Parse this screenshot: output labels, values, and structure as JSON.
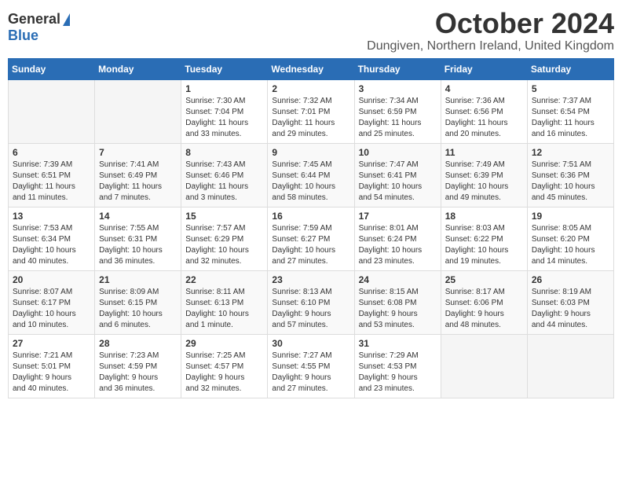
{
  "logo": {
    "general": "General",
    "blue": "Blue"
  },
  "title": "October 2024",
  "location": "Dungiven, Northern Ireland, United Kingdom",
  "headers": [
    "Sunday",
    "Monday",
    "Tuesday",
    "Wednesday",
    "Thursday",
    "Friday",
    "Saturday"
  ],
  "weeks": [
    [
      {
        "day": "",
        "info": ""
      },
      {
        "day": "",
        "info": ""
      },
      {
        "day": "1",
        "info": "Sunrise: 7:30 AM\nSunset: 7:04 PM\nDaylight: 11 hours\nand 33 minutes."
      },
      {
        "day": "2",
        "info": "Sunrise: 7:32 AM\nSunset: 7:01 PM\nDaylight: 11 hours\nand 29 minutes."
      },
      {
        "day": "3",
        "info": "Sunrise: 7:34 AM\nSunset: 6:59 PM\nDaylight: 11 hours\nand 25 minutes."
      },
      {
        "day": "4",
        "info": "Sunrise: 7:36 AM\nSunset: 6:56 PM\nDaylight: 11 hours\nand 20 minutes."
      },
      {
        "day": "5",
        "info": "Sunrise: 7:37 AM\nSunset: 6:54 PM\nDaylight: 11 hours\nand 16 minutes."
      }
    ],
    [
      {
        "day": "6",
        "info": "Sunrise: 7:39 AM\nSunset: 6:51 PM\nDaylight: 11 hours\nand 11 minutes."
      },
      {
        "day": "7",
        "info": "Sunrise: 7:41 AM\nSunset: 6:49 PM\nDaylight: 11 hours\nand 7 minutes."
      },
      {
        "day": "8",
        "info": "Sunrise: 7:43 AM\nSunset: 6:46 PM\nDaylight: 11 hours\nand 3 minutes."
      },
      {
        "day": "9",
        "info": "Sunrise: 7:45 AM\nSunset: 6:44 PM\nDaylight: 10 hours\nand 58 minutes."
      },
      {
        "day": "10",
        "info": "Sunrise: 7:47 AM\nSunset: 6:41 PM\nDaylight: 10 hours\nand 54 minutes."
      },
      {
        "day": "11",
        "info": "Sunrise: 7:49 AM\nSunset: 6:39 PM\nDaylight: 10 hours\nand 49 minutes."
      },
      {
        "day": "12",
        "info": "Sunrise: 7:51 AM\nSunset: 6:36 PM\nDaylight: 10 hours\nand 45 minutes."
      }
    ],
    [
      {
        "day": "13",
        "info": "Sunrise: 7:53 AM\nSunset: 6:34 PM\nDaylight: 10 hours\nand 40 minutes."
      },
      {
        "day": "14",
        "info": "Sunrise: 7:55 AM\nSunset: 6:31 PM\nDaylight: 10 hours\nand 36 minutes."
      },
      {
        "day": "15",
        "info": "Sunrise: 7:57 AM\nSunset: 6:29 PM\nDaylight: 10 hours\nand 32 minutes."
      },
      {
        "day": "16",
        "info": "Sunrise: 7:59 AM\nSunset: 6:27 PM\nDaylight: 10 hours\nand 27 minutes."
      },
      {
        "day": "17",
        "info": "Sunrise: 8:01 AM\nSunset: 6:24 PM\nDaylight: 10 hours\nand 23 minutes."
      },
      {
        "day": "18",
        "info": "Sunrise: 8:03 AM\nSunset: 6:22 PM\nDaylight: 10 hours\nand 19 minutes."
      },
      {
        "day": "19",
        "info": "Sunrise: 8:05 AM\nSunset: 6:20 PM\nDaylight: 10 hours\nand 14 minutes."
      }
    ],
    [
      {
        "day": "20",
        "info": "Sunrise: 8:07 AM\nSunset: 6:17 PM\nDaylight: 10 hours\nand 10 minutes."
      },
      {
        "day": "21",
        "info": "Sunrise: 8:09 AM\nSunset: 6:15 PM\nDaylight: 10 hours\nand 6 minutes."
      },
      {
        "day": "22",
        "info": "Sunrise: 8:11 AM\nSunset: 6:13 PM\nDaylight: 10 hours\nand 1 minute."
      },
      {
        "day": "23",
        "info": "Sunrise: 8:13 AM\nSunset: 6:10 PM\nDaylight: 9 hours\nand 57 minutes."
      },
      {
        "day": "24",
        "info": "Sunrise: 8:15 AM\nSunset: 6:08 PM\nDaylight: 9 hours\nand 53 minutes."
      },
      {
        "day": "25",
        "info": "Sunrise: 8:17 AM\nSunset: 6:06 PM\nDaylight: 9 hours\nand 48 minutes."
      },
      {
        "day": "26",
        "info": "Sunrise: 8:19 AM\nSunset: 6:03 PM\nDaylight: 9 hours\nand 44 minutes."
      }
    ],
    [
      {
        "day": "27",
        "info": "Sunrise: 7:21 AM\nSunset: 5:01 PM\nDaylight: 9 hours\nand 40 minutes."
      },
      {
        "day": "28",
        "info": "Sunrise: 7:23 AM\nSunset: 4:59 PM\nDaylight: 9 hours\nand 36 minutes."
      },
      {
        "day": "29",
        "info": "Sunrise: 7:25 AM\nSunset: 4:57 PM\nDaylight: 9 hours\nand 32 minutes."
      },
      {
        "day": "30",
        "info": "Sunrise: 7:27 AM\nSunset: 4:55 PM\nDaylight: 9 hours\nand 27 minutes."
      },
      {
        "day": "31",
        "info": "Sunrise: 7:29 AM\nSunset: 4:53 PM\nDaylight: 9 hours\nand 23 minutes."
      },
      {
        "day": "",
        "info": ""
      },
      {
        "day": "",
        "info": ""
      }
    ]
  ]
}
